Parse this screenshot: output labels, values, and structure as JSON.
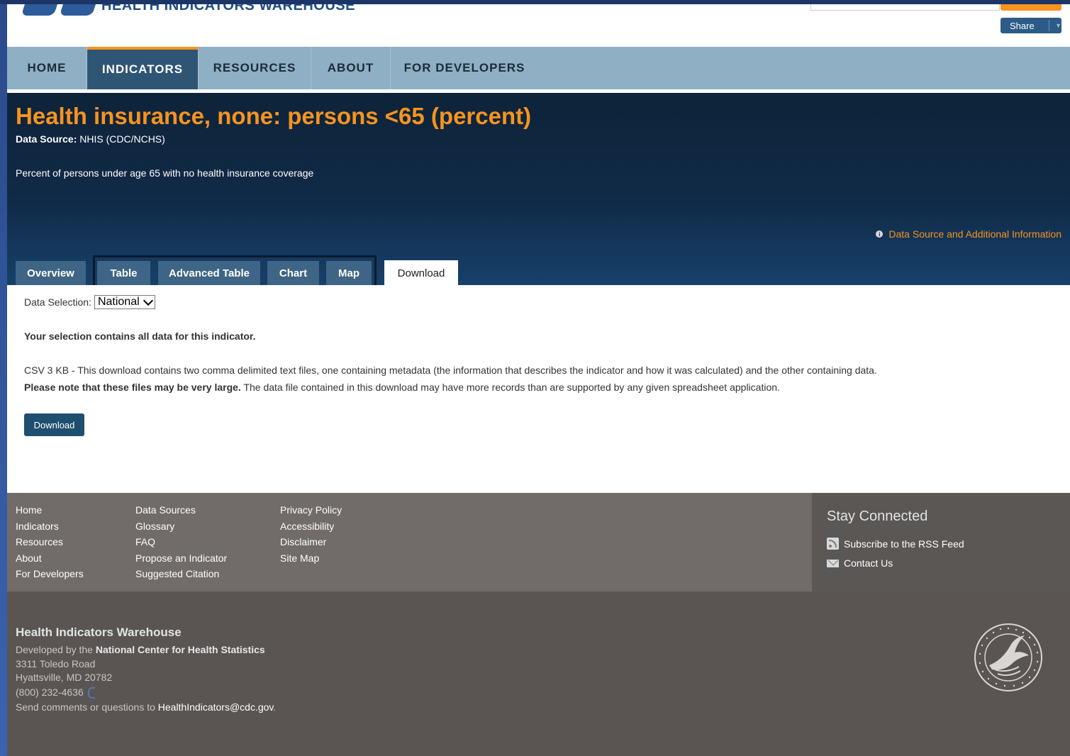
{
  "header": {
    "logo_text": "HEALTH INDICATORS WAREHOUSE",
    "share_label": "Share"
  },
  "nav": [
    {
      "label": "HOME",
      "name": "nav-home"
    },
    {
      "label": "INDICATORS",
      "name": "nav-indicators"
    },
    {
      "label": "RESOURCES",
      "name": "nav-resources"
    },
    {
      "label": "ABOUT",
      "name": "nav-about"
    },
    {
      "label": "FOR DEVELOPERS",
      "name": "nav-for-developers"
    }
  ],
  "indicator": {
    "title": "Health insurance, none: persons <65 (percent)",
    "source_label": "Data Source:",
    "source_value": " NHIS (CDC/NCHS)",
    "description": "Percent of persons under age 65 with no health insurance coverage",
    "info_link": "Data Source and Additional Information"
  },
  "tabs": [
    {
      "label": "Overview"
    },
    {
      "label": "Table"
    },
    {
      "label": "Advanced Table"
    },
    {
      "label": "Chart"
    },
    {
      "label": "Map"
    },
    {
      "label": "Download"
    }
  ],
  "content": {
    "selection_label": "Data Selection:",
    "selection_value": "National",
    "all_data": "Your selection contains all data for this indicator.",
    "csv_text": "CSV 3 KB - This download contains two comma delimited text files, one containing metadata (the information that describes the indicator and how it was calculated) and the other containing data.",
    "note_bold": "Please note that these files may be very large.",
    "note_text": " The data file contained in this download may have more records than are supported by any given spreadsheet application.",
    "download_label": "Download"
  },
  "footer": {
    "col1": [
      "Home",
      "Indicators",
      "Resources",
      "About",
      "For Developers"
    ],
    "col2": [
      "Data Sources",
      "Glossary",
      "FAQ",
      "Propose an Indicator",
      "Suggested Citation"
    ],
    "col3": [
      "Privacy Policy",
      "Accessibility",
      "Disclaimer",
      "Site Map"
    ],
    "stay_title": "Stay Connected",
    "rss": "Subscribe to the RSS Feed",
    "contact": "Contact Us"
  },
  "bottom": {
    "org": "Health Indicators Warehouse",
    "dev_prefix": "Developed by the ",
    "dev_org": "National Center for Health Statistics",
    "address1": "3311 Toledo Road",
    "address2": "Hyattsville, MD 20782",
    "phone": "(800) 232-4636",
    "comments_prefix": "Send comments or questions to ",
    "email": "HealthIndicators@cdc.gov",
    "comments_suffix": "."
  },
  "colors": {
    "accent_orange": "#f7931e",
    "nav_bg": "#8eafc4",
    "nav_active": "#2f5575",
    "hero_bg": "#102a47",
    "button": "#1f4f6e"
  }
}
